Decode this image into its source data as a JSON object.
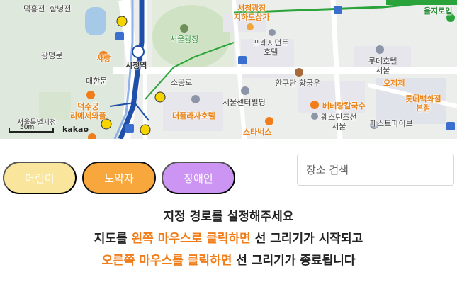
{
  "map": {
    "attribution": "kakao",
    "scale_label": "50m",
    "labels": {
      "deoksugung_road": "덕홍전",
      "hamnyeongjeon": "함녕전",
      "sarang": "사랑",
      "gwangmyeongmun": "광명문",
      "daehanmun": "대한문",
      "seoul_plaza": "서울광장",
      "city_hall_station": "시청역",
      "sogongro": "소공로",
      "seoul_center_building": "서울센터빌딩",
      "theplaza_hotel": "더플라자호텔",
      "president_hotel": "프레지던트\n호텔",
      "hwangudan": "환구단 황궁우",
      "lotte_hotel": "롯데호텔\n서울",
      "ojeje": "오제제",
      "lotte_dept": "롯데백화점\n본점",
      "veterang": "베테랑칼국수",
      "westin": "웨스틴조선\n서울",
      "pastapie": "패스트파이브",
      "starbucks": "스타벅스",
      "deoksugung_lime": "덕수궁\n리에제와플",
      "seoul_city_hall": "서울특별시청",
      "seocheong_plaza": "서청광장\n지하도상가",
      "euljiro": "을지로입"
    },
    "colors": {
      "line1": "#1f4fa8",
      "line2": "#29a33a",
      "accent": "#f7a73c"
    }
  },
  "buttons": {
    "child": "어린이",
    "elder": "노약자",
    "disabled": "장애인"
  },
  "search": {
    "placeholder": "장소 검색"
  },
  "instructions": {
    "line1": "지정 경로를 설정해주세요",
    "line2_pre": "지도를 ",
    "line2_hl": "왼쪽 마우스로 클릭하면",
    "line2_post": " 선 그리기가 시작되고",
    "line3_hl": "오른쪽 마우스를 클릭하면",
    "line3_post": " 선 그리기가 종료됩니다"
  }
}
